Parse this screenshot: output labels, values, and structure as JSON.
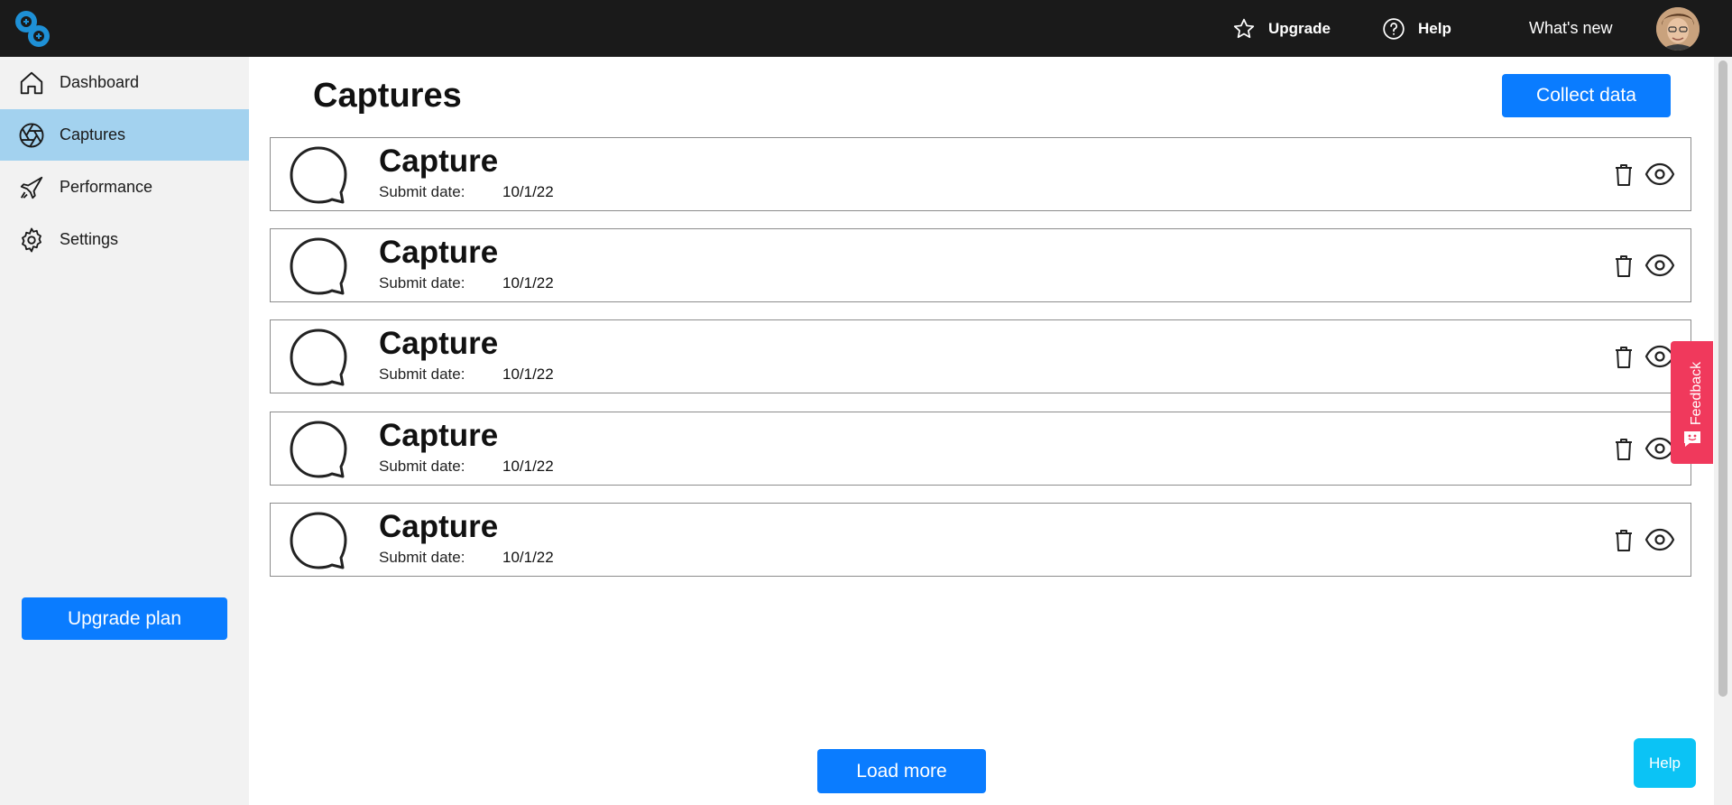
{
  "topbar": {
    "upgrade_label": "Upgrade",
    "help_label": "Help",
    "whats_new_label": "What's new"
  },
  "sidebar": {
    "items": [
      {
        "label": "Dashboard",
        "icon": "home-icon"
      },
      {
        "label": "Captures",
        "icon": "aperture-icon",
        "active": true
      },
      {
        "label": "Performance",
        "icon": "rocket-icon"
      },
      {
        "label": "Settings",
        "icon": "gear-icon"
      }
    ],
    "upgrade_plan_label": "Upgrade plan"
  },
  "main": {
    "title": "Captures",
    "collect_data_label": "Collect data",
    "captures": [
      {
        "title": "Capture",
        "date_label": "Submit date:",
        "date": "10/1/22"
      },
      {
        "title": "Capture",
        "date_label": "Submit date:",
        "date": "10/1/22"
      },
      {
        "title": "Capture",
        "date_label": "Submit date:",
        "date": "10/1/22"
      },
      {
        "title": "Capture",
        "date_label": "Submit date:",
        "date": "10/1/22"
      },
      {
        "title": "Capture",
        "date_label": "Submit date:",
        "date": "10/1/22"
      }
    ],
    "load_more_label": "Load more"
  },
  "feedback": {
    "label": "Feedback"
  },
  "help_fab": {
    "label": "Help"
  },
  "colors": {
    "topbar": "#1a1a1a",
    "accent": "#0a7cff",
    "sidebar_active": "#a3d2ef",
    "feedback": "#f0395c",
    "help_fab": "#0bc3f5"
  }
}
